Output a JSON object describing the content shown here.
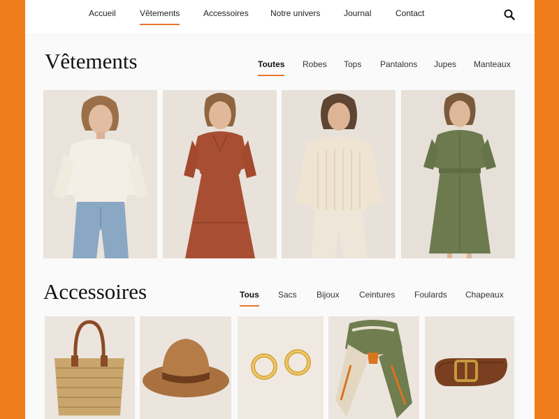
{
  "nav": {
    "items": [
      {
        "label": "Accueil",
        "active": false
      },
      {
        "label": "Vêtements",
        "active": true
      },
      {
        "label": "Accessoires",
        "active": false
      },
      {
        "label": "Notre univers",
        "active": false
      },
      {
        "label": "Journal",
        "active": false
      },
      {
        "label": "Contact",
        "active": false
      }
    ],
    "search_icon": "search-icon"
  },
  "clothing": {
    "title": "Vêtements",
    "tabs": [
      {
        "label": "Toutes",
        "active": true
      },
      {
        "label": "Robes",
        "active": false
      },
      {
        "label": "Tops",
        "active": false
      },
      {
        "label": "Pantalons",
        "active": false
      },
      {
        "label": "Jupes",
        "active": false
      },
      {
        "label": "Manteaux",
        "active": false
      }
    ],
    "products": [
      {
        "image": "model in cream blouse and light jeans"
      },
      {
        "image": "model in rust maxi dress"
      },
      {
        "image": "model in cream knit sweater and trousers"
      },
      {
        "image": "model in olive green shirt dress"
      }
    ]
  },
  "accessories": {
    "title": "Accessoires",
    "tabs": [
      {
        "label": "Tous",
        "active": true
      },
      {
        "label": "Sacs",
        "active": false
      },
      {
        "label": "Bijoux",
        "active": false
      },
      {
        "label": "Ceintures",
        "active": false
      },
      {
        "label": "Foulards",
        "active": false
      },
      {
        "label": "Chapeaux",
        "active": false
      }
    ],
    "products": [
      {
        "image": "woven straw tote bag"
      },
      {
        "image": "brown felt hat"
      },
      {
        "image": "gold hoop earrings"
      },
      {
        "image": "patterned silk scarf"
      },
      {
        "image": "brown leather belt"
      }
    ]
  },
  "colors": {
    "background": "#f07d1c",
    "accent": "#e8762c",
    "page": "#fafafa"
  }
}
